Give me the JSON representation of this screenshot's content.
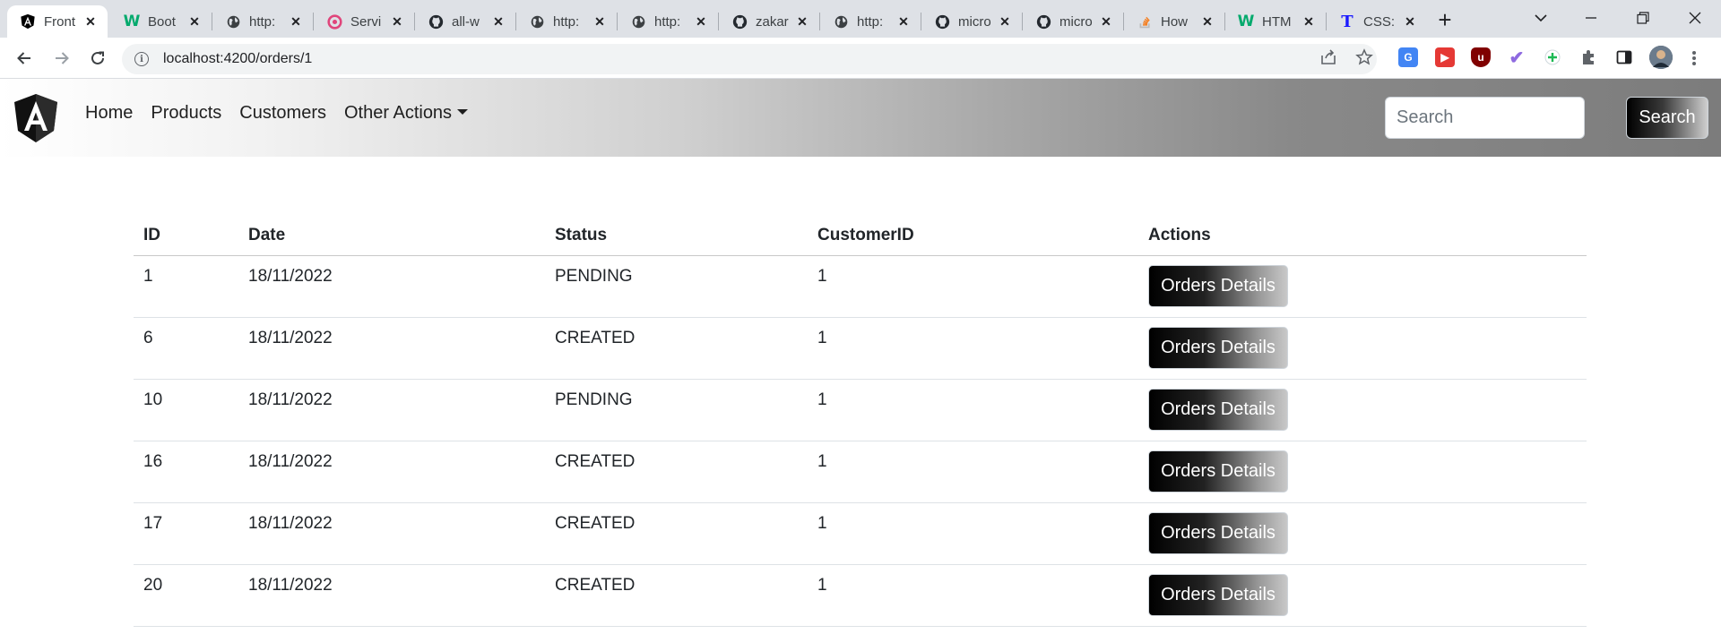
{
  "browser": {
    "tabs": [
      {
        "title": "Front",
        "icon": "angular-icon",
        "active": true
      },
      {
        "title": "Boot",
        "icon": "w3schools-icon"
      },
      {
        "title": "http:",
        "icon": "globe-icon"
      },
      {
        "title": "Servi",
        "icon": "c-logo-icon"
      },
      {
        "title": "all-w",
        "icon": "github-icon"
      },
      {
        "title": "http:",
        "icon": "globe-icon"
      },
      {
        "title": "http:",
        "icon": "globe-icon"
      },
      {
        "title": "zakar",
        "icon": "github-icon"
      },
      {
        "title": "http:",
        "icon": "globe-icon"
      },
      {
        "title": "micro",
        "icon": "github-icon"
      },
      {
        "title": "micro",
        "icon": "github-icon"
      },
      {
        "title": "How",
        "icon": "stackoverflow-icon"
      },
      {
        "title": "HTM",
        "icon": "w3schools-icon"
      },
      {
        "title": "CSS:",
        "icon": "t-logo-icon"
      }
    ],
    "url": "localhost:4200/orders/1"
  },
  "navbar": {
    "links": [
      "Home",
      "Products",
      "Customers"
    ],
    "dropdown_label": "Other Actions",
    "search_placeholder": "Search",
    "search_button": "Search"
  },
  "table": {
    "headers": {
      "id": "ID",
      "date": "Date",
      "status": "Status",
      "customer_id": "CustomerID",
      "actions": "Actions"
    },
    "rows": [
      {
        "id": "1",
        "date": "18/11/2022",
        "status": "PENDING",
        "customer_id": "1",
        "action": "Orders Details"
      },
      {
        "id": "6",
        "date": "18/11/2022",
        "status": "CREATED",
        "customer_id": "1",
        "action": "Orders Details"
      },
      {
        "id": "10",
        "date": "18/11/2022",
        "status": "PENDING",
        "customer_id": "1",
        "action": "Orders Details"
      },
      {
        "id": "16",
        "date": "18/11/2022",
        "status": "CREATED",
        "customer_id": "1",
        "action": "Orders Details"
      },
      {
        "id": "17",
        "date": "18/11/2022",
        "status": "CREATED",
        "customer_id": "1",
        "action": "Orders Details"
      },
      {
        "id": "20",
        "date": "18/11/2022",
        "status": "CREATED",
        "customer_id": "1",
        "action": "Orders Details"
      }
    ]
  },
  "colors": {
    "tabstrip": "#dee1e6",
    "navbar_dark": "#7c7c7c",
    "button_dark": "#000000"
  }
}
